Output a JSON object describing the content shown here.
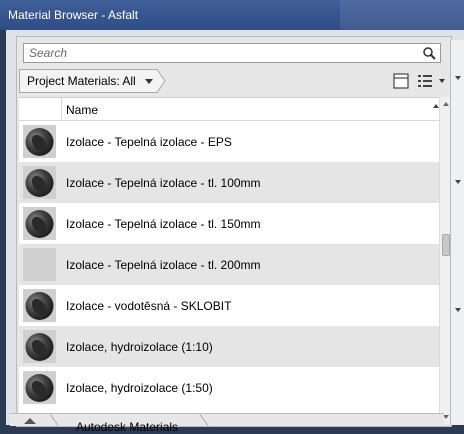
{
  "window": {
    "title": "Material Browser - Asfalt"
  },
  "search": {
    "placeholder": "Search",
    "value": ""
  },
  "breadcrumb": {
    "label": "Project Materials: All"
  },
  "list": {
    "column_header": "Name",
    "rows": [
      {
        "name": "Izolace - Tepelná izolace - EPS",
        "thumbnail": "material-sphere"
      },
      {
        "name": "Izolace - Tepelná izolace - tl. 100mm",
        "thumbnail": "material-sphere"
      },
      {
        "name": "Izolace - Tepelná izolace - tl. 150mm",
        "thumbnail": "material-sphere"
      },
      {
        "name": "Izolace - Tepelná izolace - tl. 200mm",
        "thumbnail": "blank"
      },
      {
        "name": "Izolace - vodotěsná - SKLOBIT",
        "thumbnail": "material-sphere"
      },
      {
        "name": "Izolace, hydroizolace (1:10)",
        "thumbnail": "material-sphere"
      },
      {
        "name": "Izolace, hydroizolace (1:50)",
        "thumbnail": "material-sphere"
      }
    ]
  },
  "bottom_toolbar": {
    "label": "Autodesk Materials"
  },
  "colors": {
    "title_bar": "#2f4d85",
    "panel": "#e7e7e7",
    "row_alt": "#e5e5e5"
  }
}
